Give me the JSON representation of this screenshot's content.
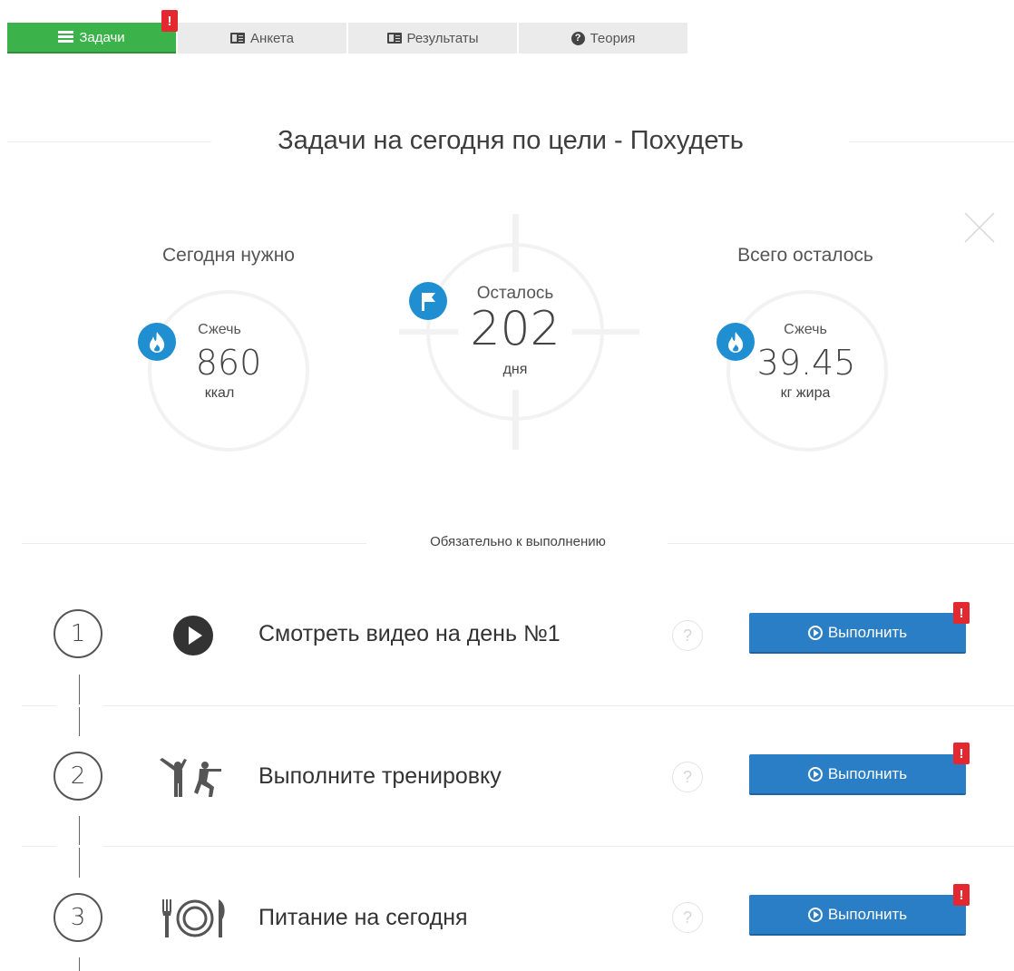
{
  "tabs": [
    {
      "label": "Задачи",
      "icon": "list-icon",
      "active": true,
      "badge": "!"
    },
    {
      "label": "Анкета",
      "icon": "id-card-icon"
    },
    {
      "label": "Результаты",
      "icon": "id-card-icon"
    },
    {
      "label": "Теория",
      "icon": "question-circle-icon"
    }
  ],
  "title": "Задачи на сегодня по цели - Похудеть",
  "stats": {
    "today": {
      "heading": "Сегодня нужно",
      "label": "Сжечь",
      "value": "860",
      "unit": "ккал",
      "icon": "flame-icon"
    },
    "remaining": {
      "label": "Осталось",
      "value": "202",
      "unit": "дня",
      "icon": "flag-icon"
    },
    "total": {
      "heading": "Всего осталось",
      "label": "Сжечь",
      "value": "39.45",
      "unit": "кг жира",
      "icon": "flame-icon"
    }
  },
  "required_label": "Обязательно к выполнению",
  "tasks": [
    {
      "number": "1",
      "title": "Смотреть видео на день №1",
      "icon": "play-circle-icon",
      "help": "?",
      "button": "Выполнить",
      "badge": "!"
    },
    {
      "number": "2",
      "title": "Выполните тренировку",
      "icon": "workout-icon",
      "help": "?",
      "button": "Выполнить",
      "badge": "!"
    },
    {
      "number": "3",
      "title": "Питание на сегодня",
      "icon": "plate-cutlery-icon",
      "help": "?",
      "button": "Выполнить",
      "badge": "!"
    }
  ],
  "colors": {
    "tab_active": "#3bb34a",
    "button": "#2a7ec6",
    "badge": "#e4282f",
    "stat_icon": "#1f8fd1"
  }
}
